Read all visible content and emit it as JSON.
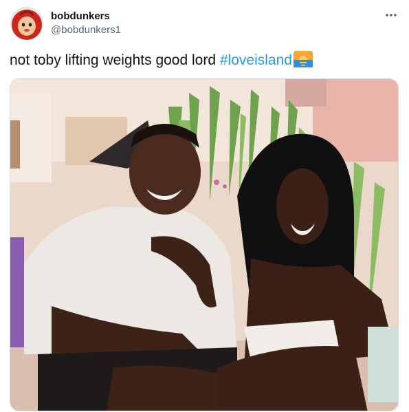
{
  "tweet": {
    "author": {
      "display_name": "bobdunkers",
      "handle": "@bobdunkers1",
      "avatar_icon": "red-hooded-toy-avatar"
    },
    "more_icon": "more-horizontal-icon",
    "text": "not toby lifting weights good lord ",
    "hashtag": "#loveisland",
    "emoji": "sunset-over-sea-emoji",
    "media": {
      "type": "photo"
    }
  },
  "colors": {
    "text_primary": "#0f1419",
    "text_secondary": "#536471",
    "link": "#1d9bf0",
    "border": "#cfd9de"
  }
}
